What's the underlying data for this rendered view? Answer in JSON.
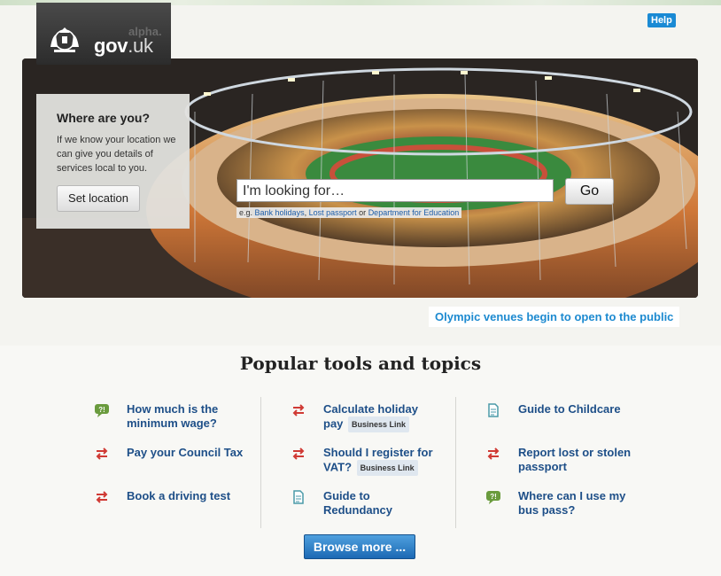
{
  "header": {
    "logo_alpha": "alpha.",
    "logo_gov": "gov",
    "logo_uk": ".uk",
    "help_label": "Help"
  },
  "location": {
    "title": "Where are you?",
    "description": "If we know your location we can give you details of services local to you.",
    "button_label": "Set location"
  },
  "search": {
    "placeholder": "I'm looking for…",
    "go_label": "Go",
    "hint_prefix": "e.g.",
    "hint_links": [
      "Bank holidays",
      "Lost passport",
      "Department for Education"
    ],
    "hint_sep1": ",",
    "hint_sep2": "or"
  },
  "feature": {
    "link": "Olympic venues begin to open to the public"
  },
  "popular": {
    "title": "Popular tools and topics",
    "topics": [
      {
        "line1": "How much is the",
        "line2": "minimum wage?",
        "icon": "speech-bubble-icon"
      },
      {
        "line1": "Pay your Council Tax",
        "icon": "transaction-arrows-icon"
      },
      {
        "line1": "Book a driving test",
        "icon": "transaction-arrows-icon"
      },
      {
        "line1": "Calculate holiday",
        "line2": "pay",
        "badge": "Business Link",
        "icon": "transaction-arrows-icon"
      },
      {
        "line1": "Should I register for",
        "line2": "VAT?",
        "badge": "Business Link",
        "icon": "transaction-arrows-icon"
      },
      {
        "line1": "Guide to",
        "line2": "Redundancy",
        "icon": "document-icon"
      },
      {
        "line1": "Guide to Childcare",
        "icon": "document-icon"
      },
      {
        "line1": "Report lost or stolen",
        "line2": "passport",
        "icon": "transaction-arrows-icon"
      },
      {
        "line1": "Where can I use my",
        "line2": "bus pass?",
        "icon": "speech-bubble-icon"
      }
    ],
    "browse_label": "Browse more ..."
  },
  "colors": {
    "accent": "#1d8ad0",
    "link": "#1e4f88",
    "button": "#1c69b4",
    "icon_green": "#6a9b3d",
    "icon_red": "#d03a34"
  }
}
